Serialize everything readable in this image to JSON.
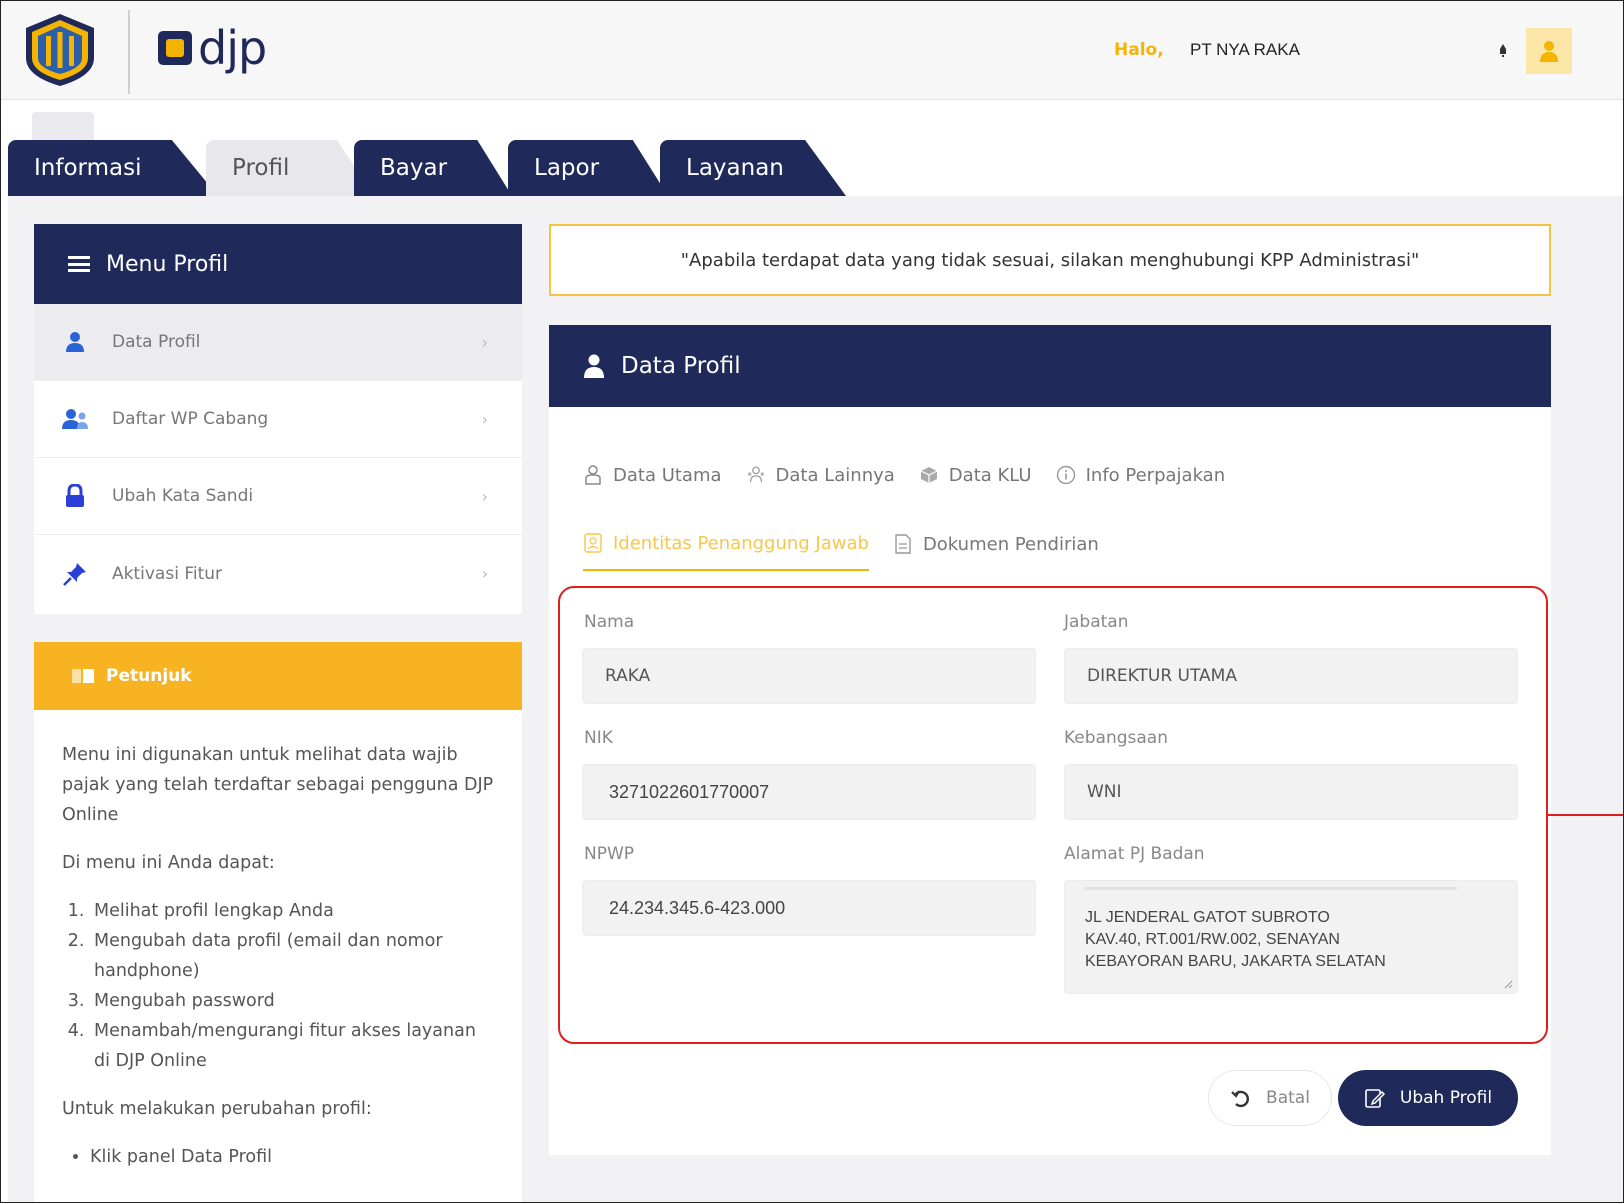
{
  "header": {
    "brand": "djp",
    "greeting": "Halo,",
    "user_name": "PT NYA RAKA"
  },
  "tabs": [
    {
      "label": "Informasi",
      "active": false
    },
    {
      "label": "Profil",
      "active": true
    },
    {
      "label": "Bayar",
      "active": false
    },
    {
      "label": "Lapor",
      "active": false
    },
    {
      "label": "Layanan",
      "active": false
    }
  ],
  "sidebar": {
    "title": "Menu Profil",
    "items": [
      {
        "label": "Data Profil",
        "icon": "user-icon",
        "active": true
      },
      {
        "label": "Daftar WP Cabang",
        "icon": "users-icon",
        "active": false
      },
      {
        "label": "Ubah Kata Sandi",
        "icon": "lock-icon",
        "active": false
      },
      {
        "label": "Aktivasi Fitur",
        "icon": "pin-icon",
        "active": false
      }
    ]
  },
  "hint": {
    "title": "Petunjuk",
    "intro": "Menu ini digunakan untuk melihat data wajib pajak yang telah terdaftar sebagai pengguna DJP Online",
    "can_do": "Di menu ini Anda dapat:",
    "list": [
      "Melihat profil lengkap Anda",
      "Mengubah data profil (email dan nomor handphone)",
      "Mengubah password",
      "Menambah/mengurangi fitur akses layanan di DJP Online"
    ],
    "change_intro": "Untuk melakukan perubahan profil:",
    "partial_step": "Klik panel Data Profil"
  },
  "notice": "\"Apabila terdapat data yang tidak sesuai, silakan menghubungi KPP Administrasi\"",
  "profile": {
    "title": "Data Profil",
    "subtabs_row1": [
      {
        "label": "Data Utama",
        "icon": "user-outline-icon"
      },
      {
        "label": "Data Lainnya",
        "icon": "users-outline-icon"
      },
      {
        "label": "Data KLU",
        "icon": "box-icon"
      },
      {
        "label": "Info Perpajakan",
        "icon": "info-icon"
      }
    ],
    "subtabs_row2": [
      {
        "label": "Identitas Penanggung Jawab",
        "icon": "id-card-icon",
        "active": true
      },
      {
        "label": "Dokumen Pendirian",
        "icon": "document-icon",
        "active": false
      }
    ],
    "fields": {
      "nama_label": "Nama",
      "nama_value": "RAKA",
      "jabatan_label": "Jabatan",
      "jabatan_value": "DIREKTUR UTAMA",
      "nik_label": "NIK",
      "nik_value": "3271022601770007",
      "kebangsaan_label": "Kebangsaan",
      "kebangsaan_value": "WNI",
      "npwp_label": "NPWP",
      "npwp_value": "24.234.345.6-423.000",
      "alamat_label": "Alamat PJ Badan",
      "alamat_lines": [
        "JL JENDERAL GATOT SUBROTO",
        "KAV.40, RT.001/RW.002, SENAYAN",
        "KEBAYORAN BARU, JAKARTA SELATAN"
      ]
    },
    "buttons": {
      "cancel": "Batal",
      "edit": "Ubah Profil"
    }
  },
  "colors": {
    "navy": "#1f2a5a",
    "accent_yellow": "#f5b400",
    "highlight_red": "#e01e1e"
  }
}
